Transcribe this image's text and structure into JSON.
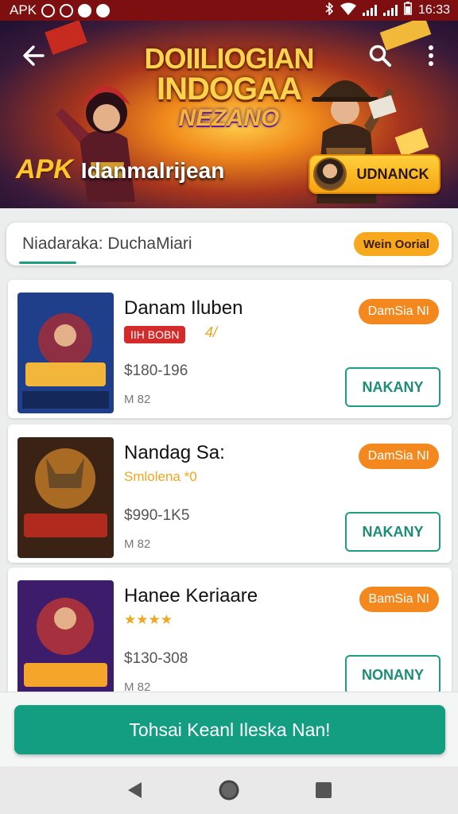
{
  "status_bar": {
    "app_label": "APK",
    "time": "16:33",
    "icons": [
      "notification-dot-icon",
      "notification-dot-icon",
      "notification-dot-icon",
      "notification-dot-icon",
      "bluetooth-icon",
      "wifi-icon",
      "signal-icon",
      "signal-icon",
      "battery-icon"
    ]
  },
  "hero": {
    "title_line1": "DOIILIOGIAN",
    "title_line2": "INDOGAA",
    "title_line3": "NEZANO",
    "brand_prefix": "APK",
    "app_name": "Idanmalrijean",
    "unlock_label": "UDNANCK",
    "icons": {
      "back": "back-arrow-icon",
      "search": "search-icon",
      "more": "more-vert-icon"
    }
  },
  "search": {
    "query": "Niadaraka: DuchaMiari",
    "mode_label": "Wein Oorial"
  },
  "items": [
    {
      "title": "Danam Iluben",
      "tag": "IIH BOBN",
      "tag_extra": "4/",
      "price": "$180-196",
      "meta": "M 82",
      "badge": "DamSia NI",
      "action": "NAKANY",
      "palette": [
        "#1f3f8a",
        "#b42b2b",
        "#f2b63a"
      ]
    },
    {
      "title": "Nandag Sa:",
      "subtitle": "Smlolena *0",
      "price": "$990-1K5",
      "meta": "M 82",
      "badge": "DamSia NI",
      "action": "NAKANY",
      "palette": [
        "#3a2315",
        "#d98a2a",
        "#b02a1e"
      ]
    },
    {
      "title": "Hanee Keriaare",
      "subtitle": "★★★★",
      "price": "$130-308",
      "meta": "M 82",
      "badge": "BamSia NI",
      "action": "NONANY",
      "palette": [
        "#3c1c6b",
        "#d03a2a",
        "#f5a62a"
      ]
    }
  ],
  "cta": {
    "label": "Tohsai Keanl Ileska Nan!"
  },
  "navbar": {
    "icons": [
      "back-triangle-icon",
      "home-circle-icon",
      "recents-square-icon"
    ]
  }
}
